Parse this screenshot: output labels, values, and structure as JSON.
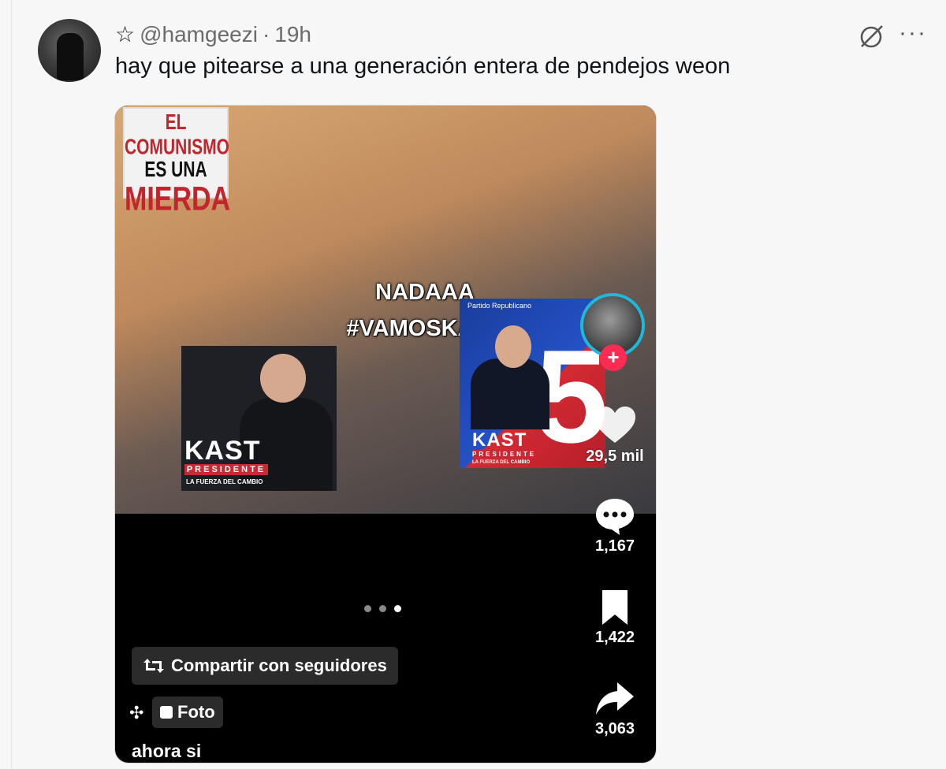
{
  "post": {
    "handle": "@hamgeezi",
    "separator": "·",
    "time": "19h",
    "text": "hay que pitearse a una generación entera de pendejos weon",
    "icons": {
      "verified": "star-outline-icon",
      "grok": "grok-icon",
      "more": "more-icon"
    },
    "more_glyph": "···"
  },
  "media": {
    "sticker": {
      "line1": "EL COMUNISMO",
      "line2": "ES UNA",
      "line3": "MIERDA"
    },
    "overlay": {
      "line1": "NADAAA",
      "line2": "#VAMOSKAST"
    },
    "kast_left": {
      "name": "KAST",
      "subtitle": "PRESIDENTE",
      "tagline": "LA FUERZA DEL CAMBIO"
    },
    "kast_right": {
      "party": "Partido Republicano",
      "name": "KAST",
      "subtitle": "PRESIDENTE",
      "tagline": "LA FUERZA DEL CAMBIO",
      "number": "5"
    },
    "plus_glyph": "+",
    "likes": "29,5 mil",
    "comments": "1,167",
    "saves": "1,422",
    "shares": "3,063",
    "share_button": {
      "icon": "repost-icon",
      "label": "Compartir con seguidores"
    },
    "pin_glyph": "✣",
    "foto_label": "Foto",
    "caption": "ahora si",
    "pager": {
      "count": 3,
      "active_index": 2
    }
  }
}
